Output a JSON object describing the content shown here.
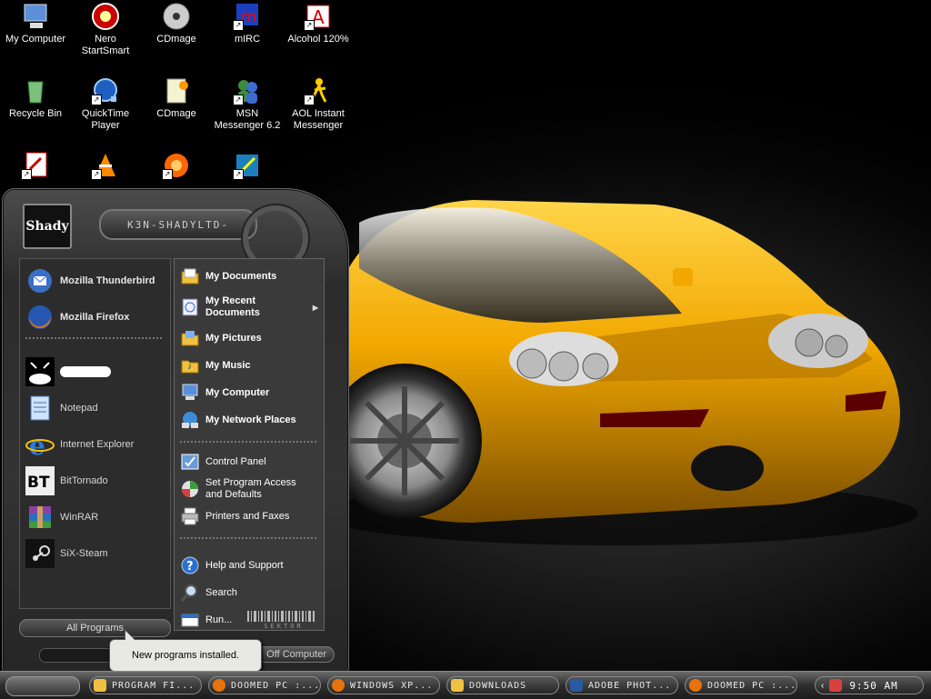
{
  "desktop": {
    "icons": [
      {
        "label": "My Computer"
      },
      {
        "label": "Nero StartSmart"
      },
      {
        "label": "CDmage"
      },
      {
        "label": "mIRC"
      },
      {
        "label": "Alcohol 120%"
      },
      {
        "label": "Recycle Bin"
      },
      {
        "label": "QuickTime Player"
      },
      {
        "label": "CDmage"
      },
      {
        "label": "MSN Messenger 6.2"
      },
      {
        "label": "AOL Instant Messenger"
      }
    ]
  },
  "start_menu": {
    "user_name": "K3N-SHADYLTD-",
    "avatar_text": "Shady",
    "pinned": [
      {
        "label": "Mozilla Thunderbird",
        "icon": "thunderbird-icon"
      },
      {
        "label": "Mozilla Firefox",
        "icon": "firefox-icon"
      }
    ],
    "recent": [
      {
        "label": "",
        "icon": "masked-user-icon"
      },
      {
        "label": "Notepad",
        "icon": "notepad-icon"
      },
      {
        "label": "Internet Explorer",
        "icon": "ie-icon"
      },
      {
        "label": "BitTornado",
        "icon": "bittornado-icon"
      },
      {
        "label": "WinRAR",
        "icon": "winrar-icon"
      },
      {
        "label": "SiX-Steam",
        "icon": "steam-icon"
      }
    ],
    "places": [
      {
        "label": "My Documents"
      },
      {
        "label": "My Recent Documents"
      },
      {
        "label": "My Pictures"
      },
      {
        "label": "My Music"
      },
      {
        "label": "My Computer"
      },
      {
        "label": "My Network Places"
      }
    ],
    "settings": [
      {
        "label": "Control Panel"
      },
      {
        "label": "Set Program Access and Defaults"
      },
      {
        "label": "Printers and Faxes"
      }
    ],
    "help": [
      {
        "label": "Help and Support"
      },
      {
        "label": "Search"
      },
      {
        "label": "Run..."
      }
    ],
    "all_programs": "All Programs",
    "turn_off": "Off Computer",
    "barcode_text": "SEKTOR"
  },
  "balloon": {
    "text": "New programs installed."
  },
  "taskbar": {
    "tasks": [
      {
        "label": "PROGRAM FI...",
        "icon": "folder-icon"
      },
      {
        "label": "DOOMED PC :...",
        "icon": "firefox-icon"
      },
      {
        "label": "WINDOWS XP...",
        "icon": "firefox-icon"
      },
      {
        "label": "DOWNLOADS",
        "icon": "folder-icon"
      },
      {
        "label": "ADOBE PHOT...",
        "icon": "photoshop-icon"
      },
      {
        "label": "DOOMED PC :...",
        "icon": "firefox-icon"
      }
    ],
    "clock": "9:50 AM"
  },
  "colors": {
    "car": "#f2a800",
    "accent": "#d4d4d4"
  }
}
